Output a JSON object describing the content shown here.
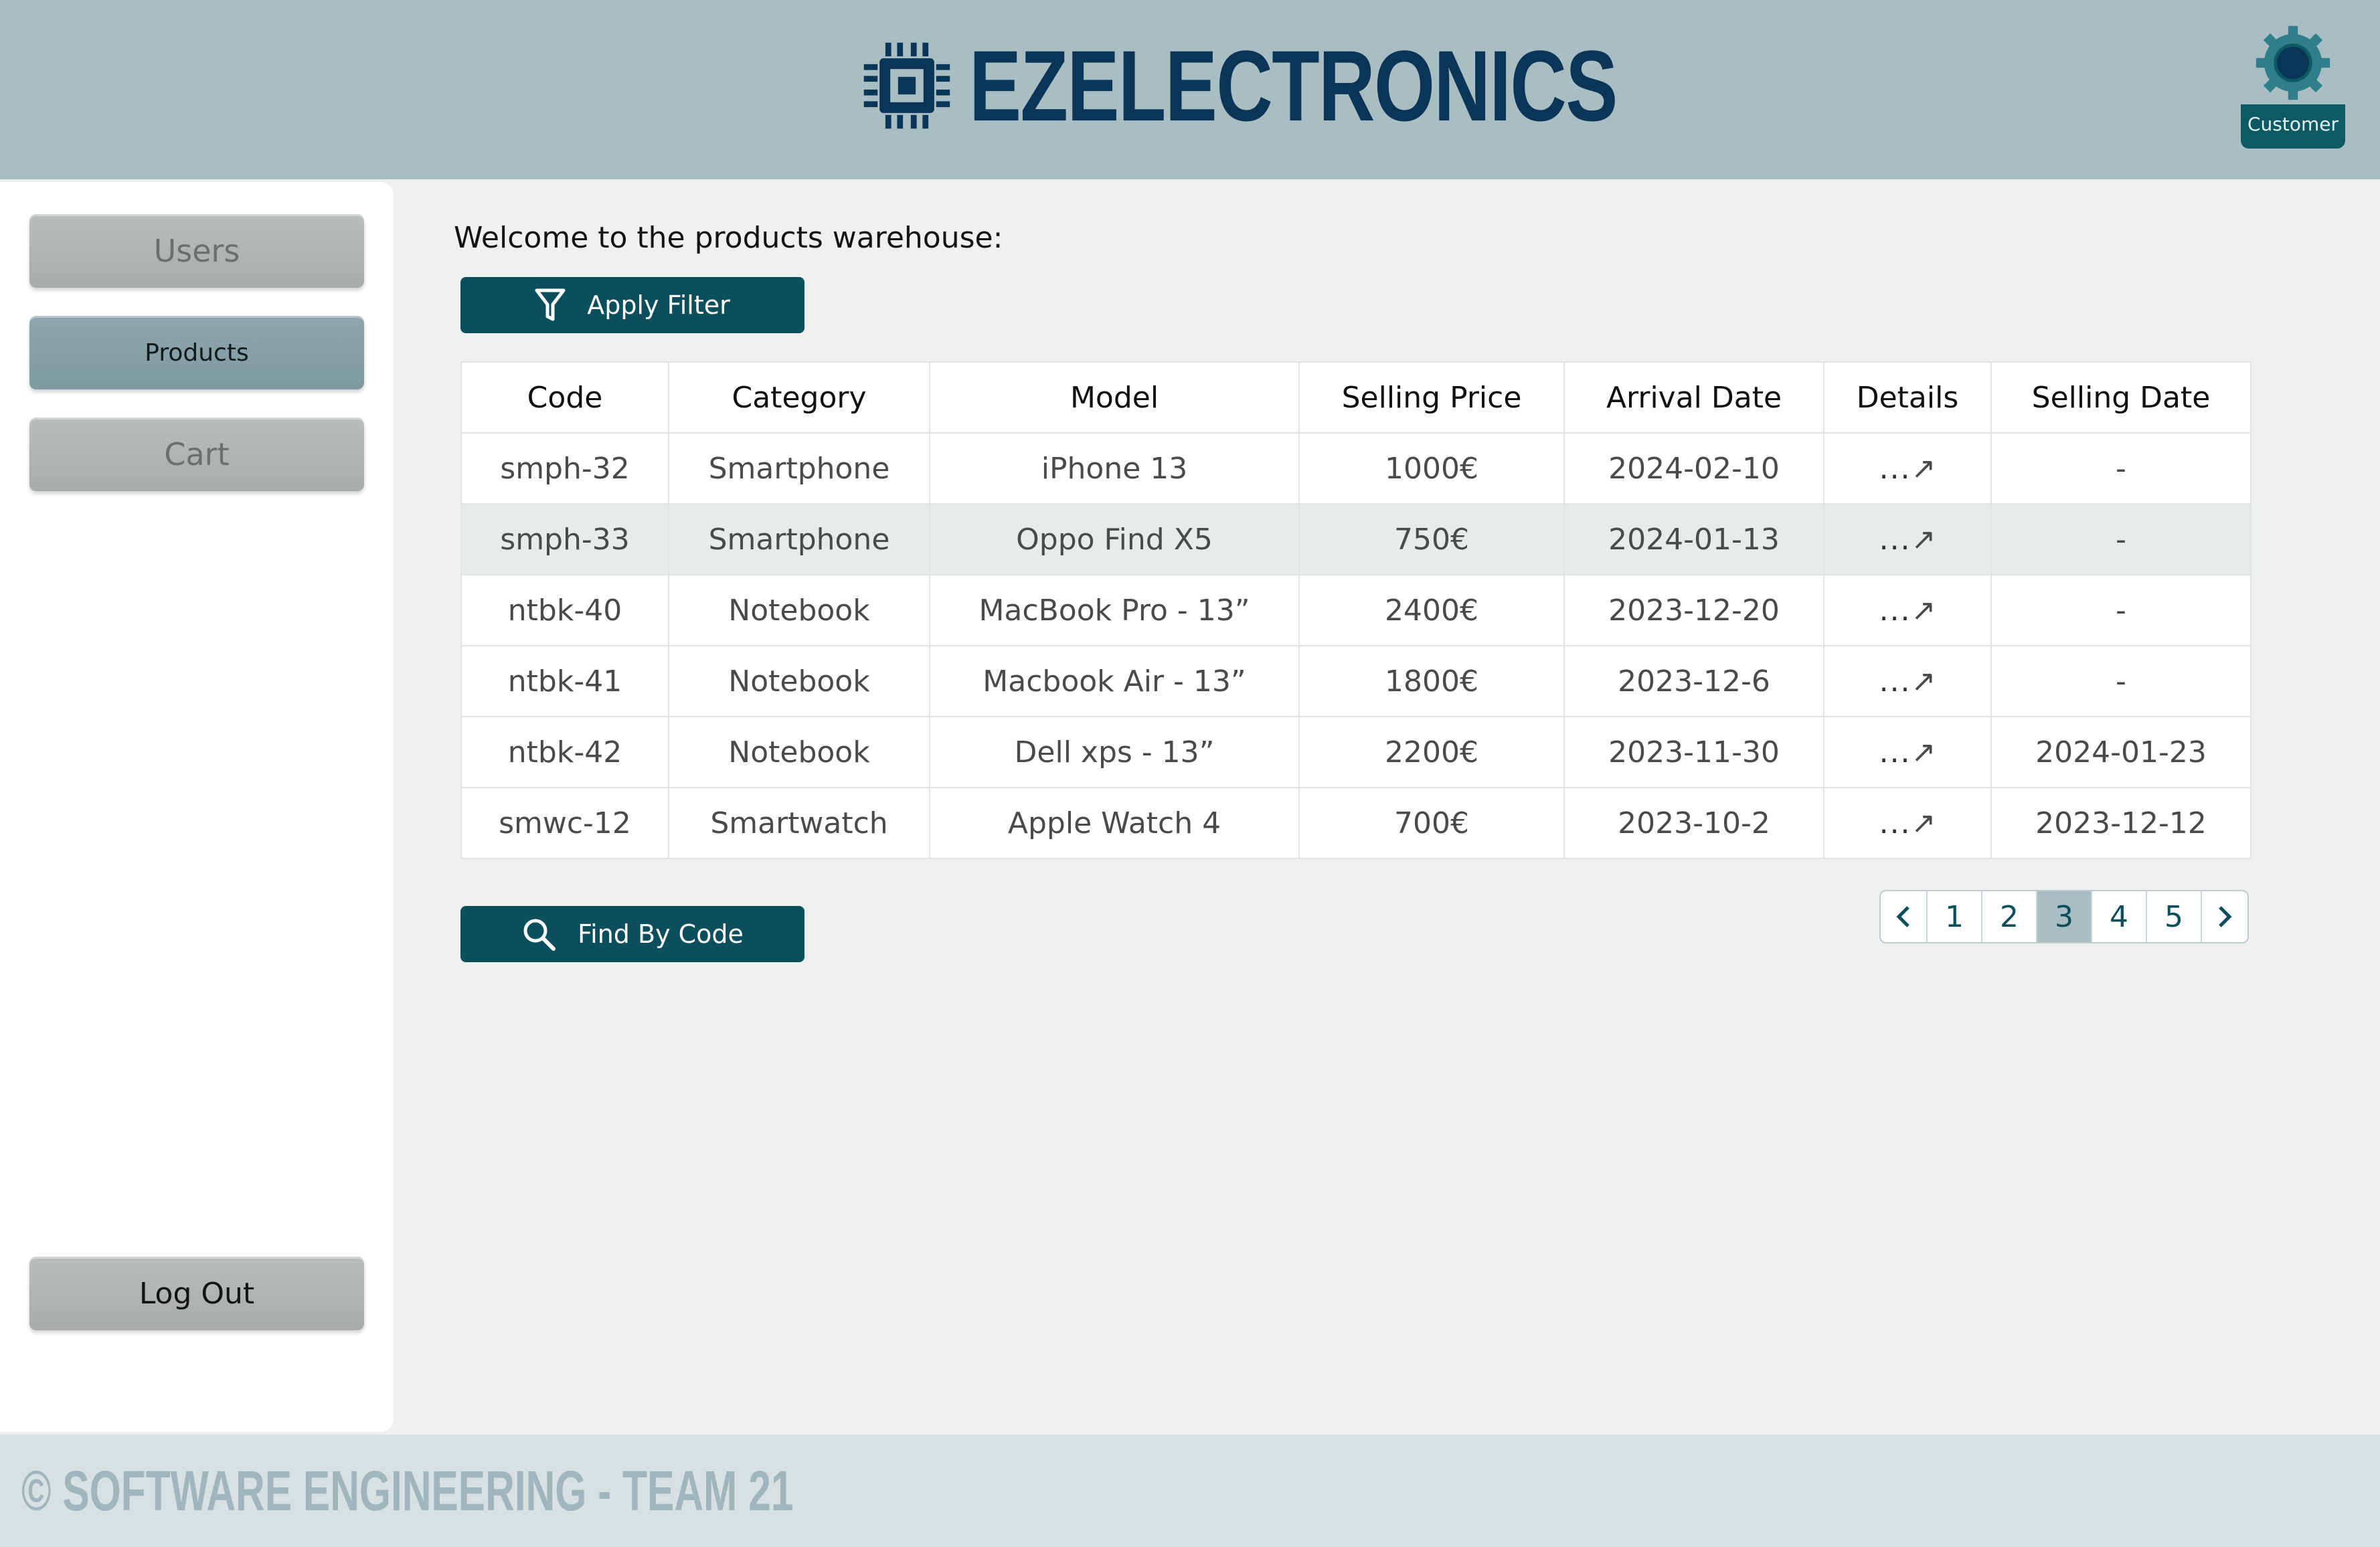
{
  "header": {
    "brand": "EZELECTRONICS",
    "logo_icon": "chip-icon",
    "user_icon": "gear-icon",
    "role": "Customer"
  },
  "sidebar": {
    "items": [
      {
        "label": "Users",
        "active": false
      },
      {
        "label": "Products",
        "active": true
      },
      {
        "label": "Cart",
        "active": false
      }
    ],
    "logout_label": "Log Out"
  },
  "main": {
    "welcome": "Welcome to the products warehouse:",
    "filter_button": {
      "label": "Apply Filter",
      "icon": "filter-icon"
    },
    "find_button": {
      "label": "Find By Code",
      "icon": "search-icon"
    },
    "table": {
      "columns": [
        "Code",
        "Category",
        "Model",
        "Selling Price",
        "Arrival Date",
        "Details",
        "Selling Date"
      ],
      "rows": [
        [
          "smph-32",
          "Smartphone",
          "iPhone 13",
          "1000€",
          "2024-02-10",
          "...",
          "-"
        ],
        [
          "smph-33",
          "Smartphone",
          "Oppo Find X5",
          "750€",
          "2024-01-13",
          "...",
          "-"
        ],
        [
          "ntbk-40",
          "Notebook",
          "MacBook Pro - 13”",
          "2400€",
          "2023-12-20",
          "...",
          "-"
        ],
        [
          "ntbk-41",
          "Notebook",
          "Macbook Air - 13”",
          "1800€",
          "2023-12-6",
          "...",
          "-"
        ],
        [
          "ntbk-42",
          "Notebook",
          "Dell xps - 13”",
          "2200€",
          "2023-11-30",
          "...",
          "2024-01-23"
        ],
        [
          "smwc-12",
          "Smartwatch",
          "Apple Watch 4",
          "700€",
          "2023-10-2",
          "...",
          "2023-12-12"
        ]
      ],
      "highlighted_row": 1
    },
    "pagination": {
      "pages": [
        "1",
        "2",
        "3",
        "4",
        "5"
      ],
      "current": "3"
    }
  },
  "footer": {
    "text": "© SOFTWARE ENGINEERING - TEAM 21"
  },
  "colors": {
    "header_bg": "#a9bec3",
    "brand": "#0b3556",
    "primary": "#0b4f5d",
    "footer_bg": "#d9e0e2"
  }
}
